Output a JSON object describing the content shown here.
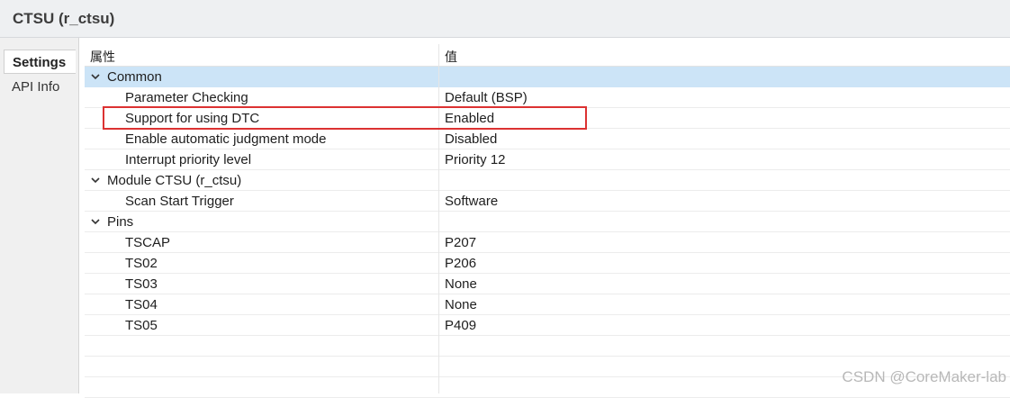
{
  "header": {
    "title": "CTSU (r_ctsu)"
  },
  "tabs": {
    "settings": "Settings",
    "api_info": "API Info"
  },
  "columns": {
    "property": "属性",
    "value": "值"
  },
  "rows": [
    {
      "label": "Common",
      "value": "",
      "group": true
    },
    {
      "label": "Parameter Checking",
      "value": "Default (BSP)",
      "group": false
    },
    {
      "label": "Support for using DTC",
      "value": "Enabled",
      "group": false
    },
    {
      "label": "Enable automatic judgment mode",
      "value": "Disabled",
      "group": false
    },
    {
      "label": "Interrupt priority level",
      "value": "Priority 12",
      "group": false
    },
    {
      "label": "Module  CTSU (r_ctsu)",
      "value": "",
      "group": true
    },
    {
      "label": "Scan Start Trigger",
      "value": "Software",
      "group": false
    },
    {
      "label": "Pins",
      "value": "",
      "group": true
    },
    {
      "label": "TSCAP",
      "value": "P207",
      "group": false
    },
    {
      "label": "TS02",
      "value": "P206",
      "group": false
    },
    {
      "label": "TS03",
      "value": "None",
      "group": false
    },
    {
      "label": "TS04",
      "value": "None",
      "group": false
    },
    {
      "label": "TS05",
      "value": "P409",
      "group": false
    },
    {
      "label": "",
      "value": "",
      "group": false
    },
    {
      "label": "",
      "value": "",
      "group": false
    },
    {
      "label": "",
      "value": "",
      "group": false
    }
  ],
  "selected_row": "Common",
  "icons": {
    "group_toggle": "chevron-down-icon"
  },
  "colors": {
    "selection": "#cce4f7",
    "highlight_box": "#dc3232"
  },
  "watermark": "CSDN @CoreMaker-lab"
}
